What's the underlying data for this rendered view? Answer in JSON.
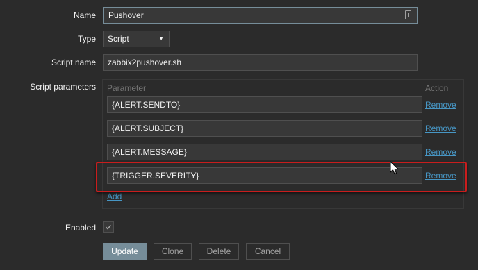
{
  "form": {
    "name_label": "Name",
    "name_value": "Pushover",
    "type_label": "Type",
    "type_value": "Script",
    "script_name_label": "Script name",
    "script_name_value": "zabbix2pushover.sh",
    "script_params_label": "Script parameters",
    "enabled_label": "Enabled",
    "enabled_checked": true
  },
  "params": {
    "col_parameter": "Parameter",
    "col_action": "Action",
    "rows": [
      {
        "value": "{ALERT.SENDTO}",
        "action": "Remove"
      },
      {
        "value": "{ALERT.SUBJECT}",
        "action": "Remove"
      },
      {
        "value": "{ALERT.MESSAGE}",
        "action": "Remove"
      },
      {
        "value": "{TRIGGER.SEVERITY}",
        "action": "Remove"
      }
    ],
    "add_label": "Add"
  },
  "buttons": {
    "update": "Update",
    "clone": "Clone",
    "delete": "Delete",
    "cancel": "Cancel"
  },
  "colors": {
    "background": "#2b2b2b",
    "input_bg": "#383838",
    "link": "#4796c4",
    "primary_button": "#768d99",
    "highlight": "#c91d1d"
  },
  "icons": {
    "type_dropdown": "chevron-down-icon",
    "name_field": "password-manager-icon",
    "enabled_checkbox": "checkmark-icon",
    "pointer": "mouse-pointer-icon"
  }
}
